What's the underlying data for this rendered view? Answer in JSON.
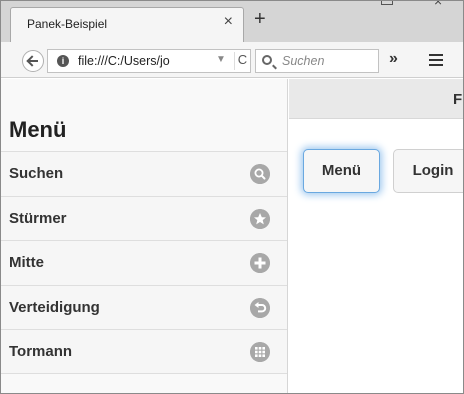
{
  "browser": {
    "tab_title": "Panek-Beispiel",
    "tab_close": "×",
    "new_tab": "+",
    "url": "file:///C:/Users/jo",
    "url_dropdown": "▼",
    "reload": "C",
    "search_placeholder": "Suchen",
    "overflow": "»"
  },
  "panel": {
    "title": "Menü",
    "items": [
      {
        "label": "Suchen",
        "icon": "search-icon"
      },
      {
        "label": "Stürmer",
        "icon": "star-icon"
      },
      {
        "label": "Mitte",
        "icon": "plus-icon"
      },
      {
        "label": "Verteidigung",
        "icon": "back-arrow-icon"
      },
      {
        "label": "Tormann",
        "icon": "grid-icon"
      }
    ]
  },
  "content": {
    "header_title": "F",
    "buttons": {
      "menu_label": "Menü",
      "login_label": "Login"
    }
  },
  "colors": {
    "focus_ring": "#6aa8e0",
    "icon_gray": "#a8a8a8"
  }
}
